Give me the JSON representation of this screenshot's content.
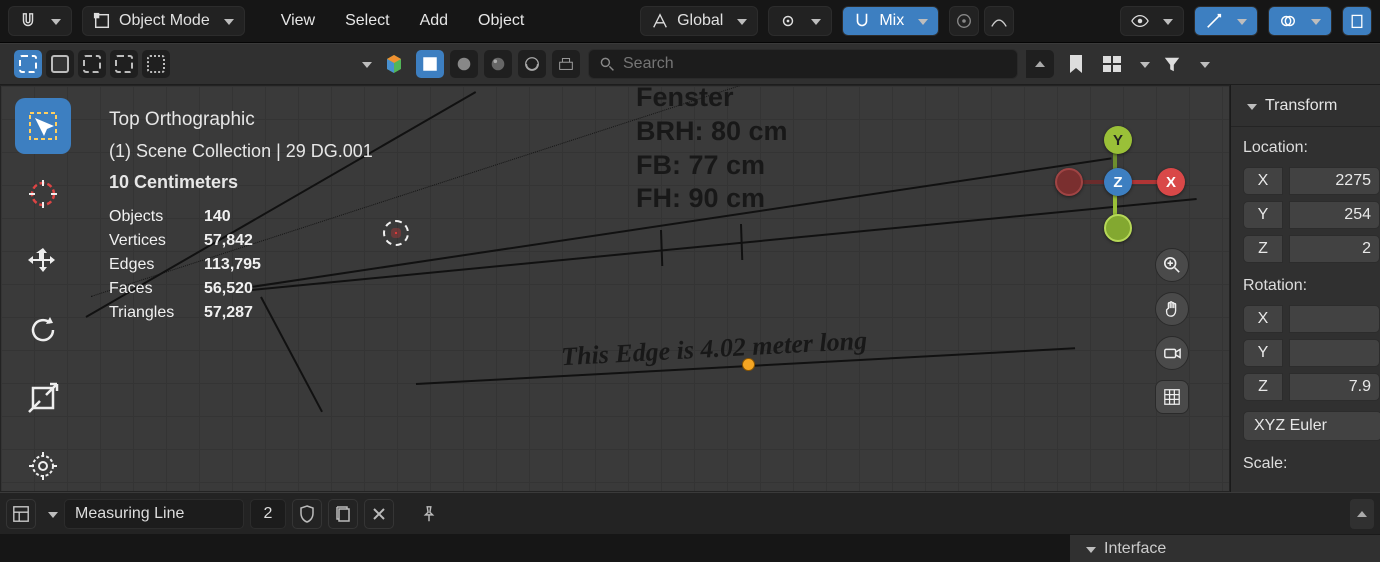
{
  "header": {
    "mode_label": "Object Mode",
    "menus": {
      "view": "View",
      "select": "Select",
      "add": "Add",
      "object": "Object"
    },
    "orientation": "Global",
    "snap_label": "Mix"
  },
  "search": {
    "placeholder": "Search"
  },
  "viewport": {
    "view_name": "Top Orthographic",
    "collection_label": "(1) Scene Collection | 29 DG.001",
    "unit_label": "10 Centimeters",
    "stat_labels": {
      "objects": "Objects",
      "vertices": "Vertices",
      "edges": "Edges",
      "faces": "Faces",
      "triangles": "Triangles"
    },
    "stats": {
      "objects": "140",
      "vertices": "57,842",
      "edges": "113,795",
      "faces": "56,520",
      "triangles": "57,287"
    },
    "window_text": {
      "title": "Fenster",
      "l1": "BRH: 80 cm",
      "l2": "FB: 77 cm",
      "l3": "FH: 90 cm"
    },
    "edge_annotation": "This Edge is 4.02 meter long",
    "gizmo": {
      "x": "X",
      "y": "Y",
      "z": "Z"
    }
  },
  "properties": {
    "panel_title": "Transform",
    "location_label": "Location:",
    "location": {
      "x_label": "X",
      "x_val": "2275",
      "y_label": "Y",
      "y_val": "254",
      "z_label": "Z",
      "z_val": "2"
    },
    "rotation_label": "Rotation:",
    "rotation": {
      "x_label": "X",
      "x_val": "",
      "y_label": "Y",
      "y_val": "",
      "z_label": "Z",
      "z_val": "7.9"
    },
    "rotation_mode": "XYZ Euler",
    "scale_label": "Scale:"
  },
  "status_bar": {
    "editor_icon_alt": "outliner-icon",
    "active_object": "Measuring Line",
    "object_users": "2"
  },
  "bottom_panel": {
    "interface_label": "Interface"
  }
}
